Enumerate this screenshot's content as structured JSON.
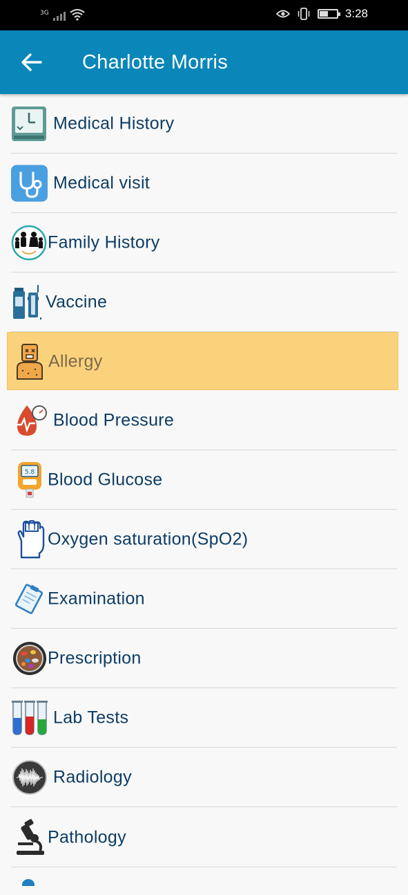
{
  "status_bar": {
    "network": "3G",
    "time": "3:28",
    "battery_level": 0.5,
    "icons": [
      "signal-icon",
      "wifi-icon",
      "eye-icon",
      "vibrate-icon",
      "battery-icon"
    ]
  },
  "app_bar": {
    "title": "Charlotte Morris",
    "color": "#0a86b8",
    "back_icon": "back-arrow-icon"
  },
  "menu": {
    "selected_index": 4,
    "highlight_color": "#fbd27c",
    "items": [
      {
        "label": "Medical History",
        "icon": "medical-history-icon"
      },
      {
        "label": "Medical visit",
        "icon": "stethoscope-icon"
      },
      {
        "label": "Family History",
        "icon": "family-icon"
      },
      {
        "label": "Vaccine",
        "icon": "vaccine-icon"
      },
      {
        "label": "Allergy",
        "icon": "allergy-icon"
      },
      {
        "label": "Blood Pressure",
        "icon": "blood-pressure-icon"
      },
      {
        "label": "Blood Glucose",
        "icon": "glucometer-icon"
      },
      {
        "label": "Oxygen saturation(SpO2)",
        "icon": "oximeter-hand-icon"
      },
      {
        "label": "Examination",
        "icon": "clipboard-icon"
      },
      {
        "label": "Prescription",
        "icon": "pills-icon"
      },
      {
        "label": "Lab Tests",
        "icon": "test-tubes-icon"
      },
      {
        "label": "Radiology",
        "icon": "radiology-icon"
      },
      {
        "label": "Pathology",
        "icon": "microscope-icon"
      }
    ]
  }
}
